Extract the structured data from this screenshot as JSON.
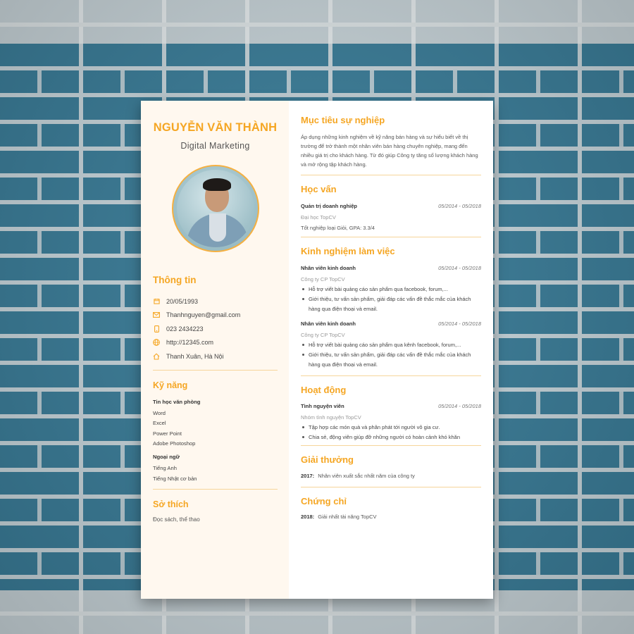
{
  "colors": {
    "accent": "#f5a623",
    "brick_blue": "#3a7d99",
    "sidebar_bg": "#fff8ef"
  },
  "cv": {
    "name": "NGUYỄN VĂN THÀNH",
    "job_title": "Digital Marketing",
    "avatar_icon": "portrait-photo",
    "info": {
      "title": "Thông tin",
      "items": [
        {
          "icon": "calendar-icon",
          "text": "20/05/1993"
        },
        {
          "icon": "mail-icon",
          "text": "Thanhnguyen@gmail.com"
        },
        {
          "icon": "phone-icon",
          "text": "023 2434223"
        },
        {
          "icon": "globe-icon",
          "text": "http://12345.com"
        },
        {
          "icon": "home-icon",
          "text": "Thanh Xuân, Hà Nội"
        }
      ]
    },
    "skills": {
      "title": "Kỹ năng",
      "groups": [
        {
          "name": "Tin học văn phòng",
          "items": [
            "Word",
            "Excel",
            "Power Point",
            "Adobe Photoshop"
          ]
        },
        {
          "name": "Ngoại ngữ",
          "items": [
            "Tiếng Anh",
            "Tiếng Nhật cơ bản"
          ]
        }
      ]
    },
    "hobbies": {
      "title": "Sở thích",
      "text": "Đọc sách, thể thao"
    },
    "objective": {
      "title": "Mục tiêu sự nghiệp",
      "text": "Áp dụng những kinh nghiệm về kỹ năng bán hàng và sự hiểu biết về thị trường để trở thành một nhân viên bán hàng chuyên nghiệp, mang đến nhiều giá trị cho khách hàng. Từ đó giúp Công ty tăng số lượng khách hàng và mở rộng tập khách hàng."
    },
    "education": {
      "title": "Học vấn",
      "role": "Quản trị doanh nghiệp",
      "date": "05/2014 - 05/2018",
      "org": "Đại học TopCV",
      "text": "Tốt nghiệp loại Giỏi, GPA: 3.3/4"
    },
    "experience": {
      "title": "Kinh nghiệm làm việc",
      "jobs": [
        {
          "role": "Nhân viên kinh doanh",
          "date": "05/2014 - 05/2018",
          "org": "Công ty CP TopCV",
          "bullets": [
            "Hỗ trợ viết bài quảng cáo sản phẩm qua facebook, forum,...",
            "Giới thiệu, tư vấn sản phẩm, giải đáp các vấn đề thắc mắc của khách hàng qua điện thoại và email."
          ]
        },
        {
          "role": "Nhân viên kinh doanh",
          "date": "05/2014 - 05/2018",
          "org": "Công ty CP TopCV",
          "bullets": [
            "Hỗ trợ viết bài quảng cáo sản phẩm qua kênh facebook, forum,...",
            "Giới thiệu, tư vấn sản phẩm, giải đáp các vấn đề thắc mắc của khách hàng qua điện thoại và email."
          ]
        }
      ]
    },
    "activities": {
      "title": "Hoạt động",
      "role": "Tình nguyện viên",
      "date": "05/2014 - 05/2018",
      "org": "Nhóm tình nguyện TopCV",
      "bullets": [
        "Tập hợp các món quà và phân phát tới người vô gia cư.",
        "Chia sẻ, động viên giúp đỡ những người có hoàn cảnh khó khăn"
      ]
    },
    "awards": {
      "title": "Giải thưởng",
      "year": "2017:",
      "text": "Nhân viên xuất sắc nhất năm của công ty"
    },
    "certificates": {
      "title": "Chứng chỉ",
      "year": "2018:",
      "text": "Giải nhất tài năng TopCV"
    }
  }
}
